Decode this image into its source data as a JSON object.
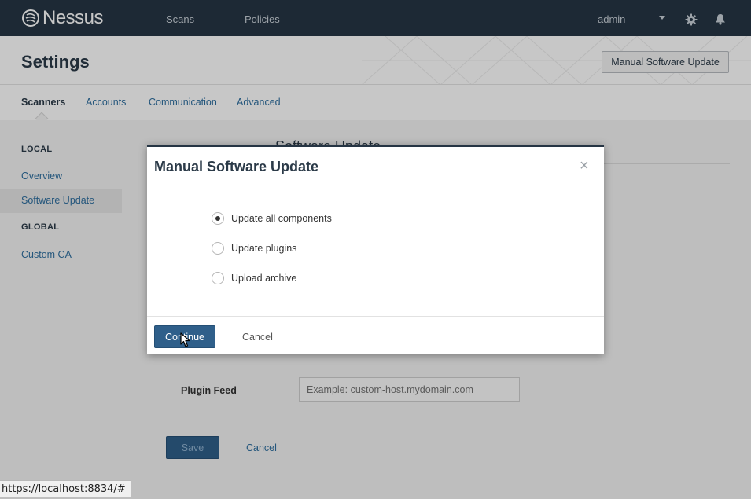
{
  "topbar": {
    "brand": "Nessus",
    "nav": [
      "Scans",
      "Policies"
    ],
    "user": "admin",
    "icons": [
      "caret-down-icon",
      "gear-icon",
      "bell-icon"
    ]
  },
  "header": {
    "title": "Settings",
    "action_button": "Manual Software Update"
  },
  "tabs": [
    {
      "label": "Scanners",
      "active": true
    },
    {
      "label": "Accounts",
      "active": false
    },
    {
      "label": "Communication",
      "active": false
    },
    {
      "label": "Advanced",
      "active": false
    }
  ],
  "sidebar": {
    "local_heading": "LOCAL",
    "local_items": [
      {
        "label": "Overview",
        "active": false
      },
      {
        "label": "Software Update",
        "active": true
      }
    ],
    "global_heading": "GLOBAL",
    "global_items": [
      {
        "label": "Custom CA",
        "active": false
      }
    ]
  },
  "main": {
    "section_title": "Software Update",
    "plugin_feed_label": "Plugin Feed",
    "plugin_feed_placeholder": "Example: custom-host.mydomain.com",
    "save_label": "Save",
    "cancel_label": "Cancel"
  },
  "modal": {
    "title": "Manual Software Update",
    "close_glyph": "×",
    "options": [
      {
        "label": "Update all components",
        "checked": true
      },
      {
        "label": "Update plugins",
        "checked": false
      },
      {
        "label": "Upload archive",
        "checked": false
      }
    ],
    "continue_label": "Continue",
    "cancel_label": "Cancel"
  },
  "statusbar": {
    "url": "https://localhost:8834/#"
  },
  "colors": {
    "topbar": "#263544",
    "primary_button": "#2f5f8a",
    "link": "#2f6f9f"
  }
}
